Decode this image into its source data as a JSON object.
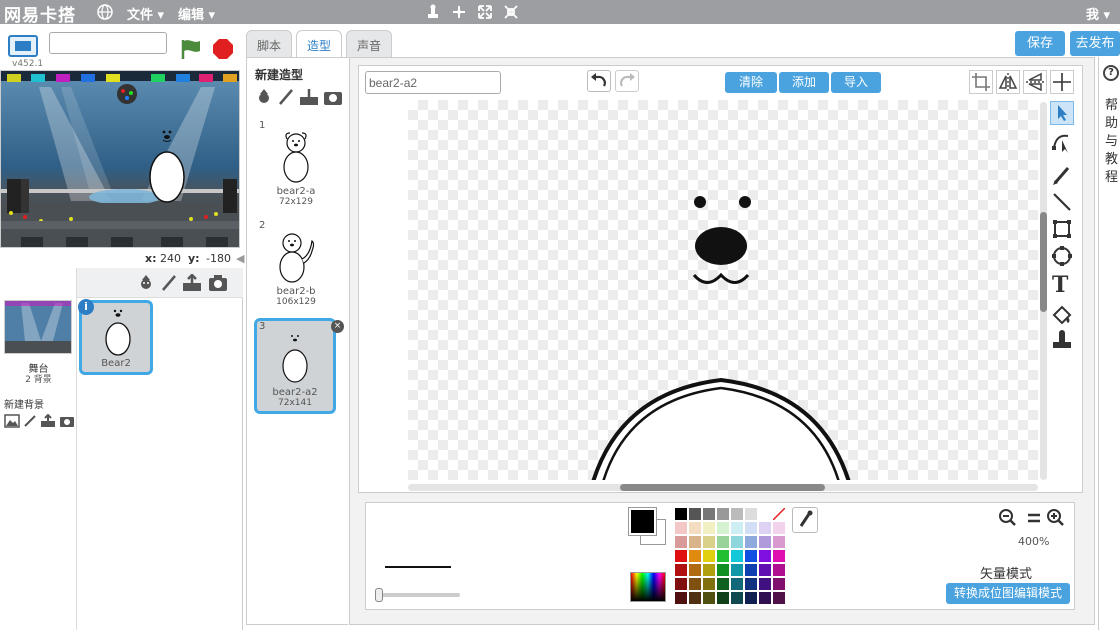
{
  "menubar": {
    "brand": "网易卡搭",
    "file_menu": "文件",
    "edit_menu": "编辑",
    "user_menu": "我"
  },
  "stage_header": {
    "version": "v452.1",
    "project_title_value": ""
  },
  "stage": {
    "coords_x_label": "x:",
    "coords_x": "240",
    "coords_y_label": "y:",
    "coords_y": "-180"
  },
  "sprites_panel": {
    "stage_label": "舞台",
    "stage_backdrops": "2 背景",
    "new_backdrop_label": "新建背景",
    "sprites": [
      {
        "name": "Bear2"
      }
    ]
  },
  "tabs": [
    {
      "label": "脚本"
    },
    {
      "label": "造型"
    },
    {
      "label": "声音"
    }
  ],
  "costumes_panel": {
    "new_costume_label": "新建造型",
    "costumes": [
      {
        "index": "1",
        "name": "bear2-a",
        "size": "72x129"
      },
      {
        "index": "2",
        "name": "bear2-b",
        "size": "106x129"
      },
      {
        "index": "3",
        "name": "bear2-a2",
        "size": "72x141"
      }
    ]
  },
  "editor": {
    "costume_name_value": "bear2-a2",
    "clear_label": "清除",
    "add_label": "添加",
    "import_label": "导入",
    "save_label": "保存",
    "publish_label": "去发布",
    "zoom_level": "400%",
    "mode_label": "矢量模式",
    "convert_label": "转换成位图编辑模式"
  },
  "help": {
    "label_chars": [
      "帮",
      "助",
      "与",
      "教",
      "程"
    ]
  },
  "colors": {
    "accent": "#4aa3df",
    "topbar": "#9c9ea1",
    "selection_border": "#41a8e6",
    "stop": "#e02020",
    "flag": "#4c8b3c"
  },
  "palette_rows": [
    [
      "#000000",
      "#555555",
      "#777777",
      "#999999",
      "#bbbbbb",
      "#dddddd",
      "#ffffff",
      "none"
    ],
    [
      "#f4c7c7",
      "#f3dcc0",
      "#f2efc3",
      "#d4f1d0",
      "#cdeff3",
      "#d2def3",
      "#ddd2f3",
      "#f3d2ec"
    ],
    [
      "#d99a9a",
      "#d9b48a",
      "#d9d08a",
      "#9ad39a",
      "#8fd6dc",
      "#8eaadd",
      "#b09adc",
      "#d99ad0"
    ],
    [
      "#e01010",
      "#e08a10",
      "#e0d010",
      "#20c030",
      "#10c8d8",
      "#1050e0",
      "#8010e0",
      "#e010b0"
    ],
    [
      "#b01010",
      "#b06a10",
      "#b0a010",
      "#109020",
      "#1098a8",
      "#1040b0",
      "#6010b0",
      "#b01090"
    ],
    [
      "#801010",
      "#805010",
      "#807010",
      "#106020",
      "#106878",
      "#103080",
      "#401080",
      "#801070"
    ],
    [
      "#501010",
      "#503010",
      "#505010",
      "#104018",
      "#104850",
      "#102050",
      "#301050",
      "#501048"
    ]
  ]
}
